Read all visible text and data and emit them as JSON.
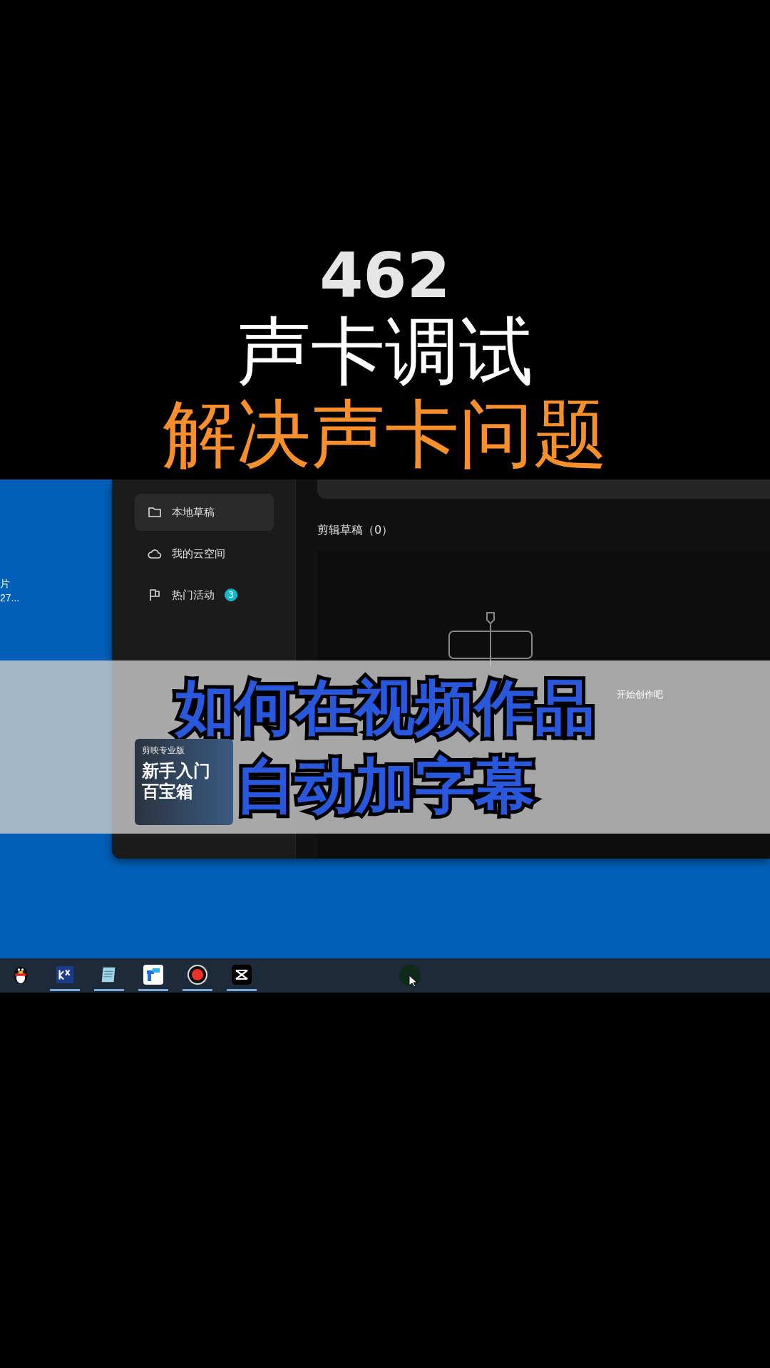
{
  "video_title": {
    "number": "462",
    "line_1": "声卡调试",
    "line_2": "解决声卡问题"
  },
  "desktop": {
    "icon_label_lines": [
      "片",
      "27..."
    ]
  },
  "app": {
    "sidebar": {
      "items": [
        {
          "label": "本地草稿",
          "kind": "folder",
          "selected": true
        },
        {
          "label": "我的云空间",
          "kind": "cloud",
          "selected": false
        },
        {
          "label": "热门活动",
          "kind": "flag",
          "selected": false,
          "badge": "3"
        }
      ],
      "banner": {
        "brand": "剪映专业版",
        "line_1": "新手入门",
        "line_2": "百宝箱"
      }
    },
    "main": {
      "section_title": "剪辑草稿（0）",
      "empty_hint": "开始创作吧"
    }
  },
  "caption_overlay": {
    "lines": [
      "如何在视频作品",
      "自动加字幕"
    ]
  },
  "taskbar": {
    "apps": [
      {
        "kind": "penguin",
        "running": false
      },
      {
        "kind": "kx",
        "running": true
      },
      {
        "kind": "notepad",
        "running": true
      },
      {
        "kind": "blue-app",
        "running": true
      },
      {
        "kind": "record",
        "running": true
      },
      {
        "kind": "capcut",
        "running": true
      }
    ]
  }
}
